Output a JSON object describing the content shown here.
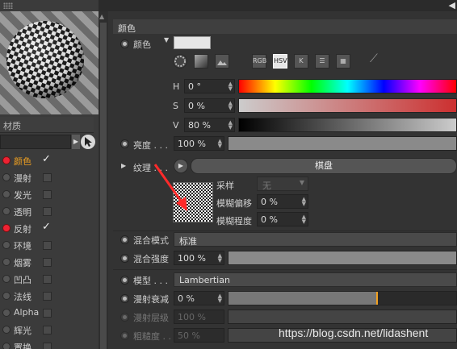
{
  "sidebar": {
    "material_label": "材质",
    "channels": [
      {
        "label": "颜色",
        "checked": true,
        "active": true
      },
      {
        "label": "漫射",
        "checked": false
      },
      {
        "label": "发光",
        "checked": false
      },
      {
        "label": "透明",
        "checked": false
      },
      {
        "label": "反射",
        "checked": true
      },
      {
        "label": "环境",
        "checked": false
      },
      {
        "label": "烟雾",
        "checked": false
      },
      {
        "label": "凹凸",
        "checked": false
      },
      {
        "label": "法线",
        "checked": false
      },
      {
        "label": "Alpha",
        "checked": false
      },
      {
        "label": "辉光",
        "checked": false
      },
      {
        "label": "置换",
        "checked": false
      }
    ]
  },
  "header": {
    "title": "颜色"
  },
  "color": {
    "label": "颜色",
    "modes": [
      "RGB",
      "HSV",
      "K"
    ],
    "active_mode": "HSV",
    "h_label": "H",
    "h_value": "0 °",
    "s_label": "S",
    "s_value": "0 %",
    "v_label": "V",
    "v_value": "80 %"
  },
  "brightness": {
    "label": "亮度 . . .",
    "value": "100 %",
    "percent": 100
  },
  "texture": {
    "label": "纹理 . . .",
    "button": "棋盘",
    "sampling_label": "采样",
    "sampling_value": "无",
    "blur_offset_label": "模糊偏移",
    "blur_offset_value": "0 %",
    "blur_scale_label": "模糊程度",
    "blur_scale_value": "0 %"
  },
  "mix_mode": {
    "label": "混合模式",
    "value": "标准"
  },
  "mix_strength": {
    "label": "混合强度",
    "value": "100 %",
    "percent": 100
  },
  "model": {
    "label": "模型 . . .",
    "value": "Lambertian"
  },
  "diffuse_falloff": {
    "label": "漫射衰减",
    "value": "0 %"
  },
  "diffuse_level": {
    "label": "漫射层级",
    "value": "100 %"
  },
  "roughness": {
    "label": "粗糙度 . . .",
    "value": "50 %"
  },
  "watermark": "https://blog.csdn.net/lidashent",
  "colors": {
    "accent": "#f0a020",
    "active_dot": "#e23",
    "arrow": "#ff2a2a"
  }
}
